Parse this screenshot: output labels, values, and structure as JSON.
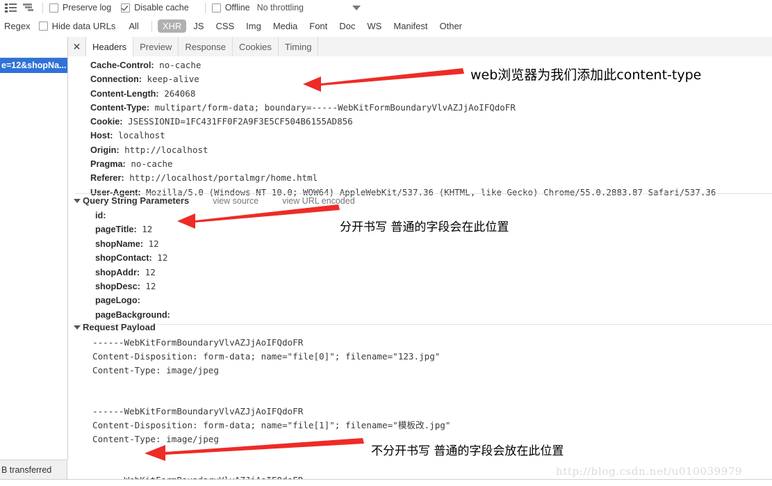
{
  "toolbar": {
    "icons": [
      "list-view-icon",
      "waterfall-icon"
    ],
    "preserve_log_label": "Preserve log",
    "preserve_log_checked": false,
    "disable_cache_label": "Disable cache",
    "disable_cache_checked": true,
    "offline_label": "Offline",
    "offline_checked": false,
    "throttling_value": "No throttling"
  },
  "filterbar": {
    "regex_label": "Regex",
    "hide_data_urls_label": "Hide data URLs",
    "hide_data_urls_checked": false,
    "types": [
      {
        "label": "All",
        "active": false
      },
      {
        "label": "XHR",
        "active": true
      },
      {
        "label": "JS",
        "active": false
      },
      {
        "label": "CSS",
        "active": false
      },
      {
        "label": "Img",
        "active": false
      },
      {
        "label": "Media",
        "active": false
      },
      {
        "label": "Font",
        "active": false
      },
      {
        "label": "Doc",
        "active": false
      },
      {
        "label": "WS",
        "active": false
      },
      {
        "label": "Manifest",
        "active": false
      },
      {
        "label": "Other",
        "active": false
      }
    ]
  },
  "left_pane": {
    "selected_request": "e=12&shopNa...",
    "status_text": "B transferred"
  },
  "detail_tabs": {
    "close_label": "✕",
    "tabs": [
      {
        "label": "Headers",
        "active": true
      },
      {
        "label": "Preview",
        "active": false
      },
      {
        "label": "Response",
        "active": false
      },
      {
        "label": "Cookies",
        "active": false
      },
      {
        "label": "Timing",
        "active": false
      }
    ]
  },
  "request_headers": [
    {
      "name": "Cache-Control:",
      "value": "no-cache"
    },
    {
      "name": "Connection:",
      "value": "keep-alive"
    },
    {
      "name": "Content-Length:",
      "value": "264068"
    },
    {
      "name": "Content-Type:",
      "value": "multipart/form-data; boundary=-----WebKitFormBoundaryVlvAZJjAoIFQdoFR"
    },
    {
      "name": "Cookie:",
      "value": "JSESSIONID=1FC431FF0F2A9F3E5CF504B6155AD856"
    },
    {
      "name": "Host:",
      "value": "localhost"
    },
    {
      "name": "Origin:",
      "value": "http://localhost"
    },
    {
      "name": "Pragma:",
      "value": "no-cache"
    },
    {
      "name": "Referer:",
      "value": "http://localhost/portalmgr/home.html"
    },
    {
      "name": "User-Agent:",
      "value": "Mozilla/5.0 (Windows NT 10.0; WOW64) AppleWebKit/537.36 (KHTML, like Gecko) Chrome/55.0.2883.87 Safari/537.36"
    }
  ],
  "query_string": {
    "title": "Query String Parameters",
    "view_source_label": "view source",
    "view_url_encoded_label": "view URL encoded",
    "params": [
      {
        "name": "id:",
        "value": ""
      },
      {
        "name": "pageTitle:",
        "value": "12"
      },
      {
        "name": "shopName:",
        "value": "12"
      },
      {
        "name": "shopContact:",
        "value": "12"
      },
      {
        "name": "shopAddr:",
        "value": "12"
      },
      {
        "name": "shopDesc:",
        "value": "12"
      },
      {
        "name": "pageLogo:",
        "value": ""
      },
      {
        "name": "pageBackground:",
        "value": ""
      }
    ]
  },
  "request_payload": {
    "title": "Request Payload",
    "lines": [
      "------WebKitFormBoundaryVlvAZJjAoIFQdoFR",
      "Content-Disposition: form-data; name=\"file[0]\"; filename=\"123.jpg\"",
      "Content-Type: image/jpeg",
      "",
      "",
      "------WebKitFormBoundaryVlvAZJjAoIFQdoFR",
      "Content-Disposition: form-data; name=\"file[1]\"; filename=\"模板改.jpg\"",
      "Content-Type: image/jpeg",
      "",
      "",
      "------WebKitFormBoundaryVlvAZJjAoIFQdoFR--"
    ]
  },
  "annotations": [
    {
      "text": "web浏览器为我们添加此content-type",
      "color": "#000000"
    },
    {
      "text": "分开书写 普通的字段会在此位置",
      "color": "#000000"
    },
    {
      "text": "不分开书写 普通的字段会放在此位置",
      "color": "#000000"
    }
  ],
  "arrow_color": "#ee2b26",
  "watermark": "http://blog.csdn.net/u010039979"
}
